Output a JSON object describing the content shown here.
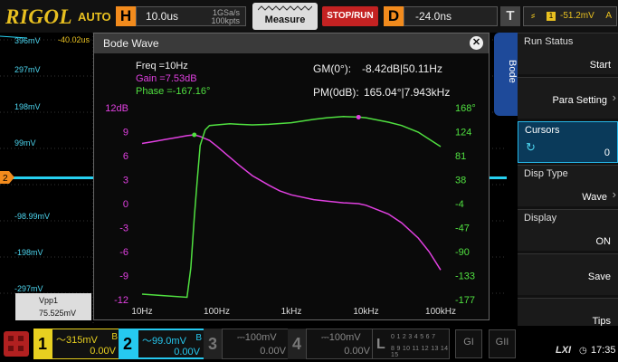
{
  "header": {
    "brand": "RIGOL",
    "mode": "AUTO",
    "horizontal": {
      "key": "H",
      "timebase": "10.0us",
      "sample_rate": "1GSa/s",
      "memory_depth": "100kpts"
    },
    "measure_label": "Measure",
    "run_state_label": "STOP/RUN",
    "delay": {
      "key": "D",
      "value": "-24.0ns"
    },
    "trigger": {
      "key": "T",
      "channel": "1",
      "level": "-51.2mV",
      "mode": "A"
    }
  },
  "waveform": {
    "scale_labels": [
      "396mV",
      "297mV",
      "198mV",
      "99mV",
      "-98.99mV",
      "-198mV",
      "-297mV"
    ],
    "offset_label": "-40.02us",
    "measurement": {
      "name": "Vpp1",
      "value": "75.525mV"
    }
  },
  "dialog": {
    "title": "Bode Wave",
    "freq_label": "Freq =10Hz",
    "gain_label": "Gain =7.53dB",
    "phase_label": "Phase =-167.16°",
    "gm_label": "GM(0°):",
    "gm_value": "-8.42dB|50.11Hz",
    "pm_label": "PM(0dB):",
    "pm_value": "165.04°|7.943kHz"
  },
  "chart_data": {
    "type": "line",
    "title": "",
    "x_scale": "log",
    "xlim": [
      10,
      100000
    ],
    "x_ticks": [
      "10Hz",
      "100Hz",
      "1kHz",
      "10kHz",
      "100kHz"
    ],
    "y_left": {
      "label": "",
      "unit": "dB",
      "lim": [
        -12,
        12
      ],
      "ticks": [
        "12dB",
        "9",
        "6",
        "3",
        "0",
        "-3",
        "-6",
        "-9",
        "-12"
      ]
    },
    "y_right": {
      "label": "",
      "unit": "°",
      "lim": [
        -177,
        168
      ],
      "ticks": [
        "168°",
        "124",
        "81",
        "38",
        "-4",
        "-47",
        "-90",
        "-133",
        "-177"
      ]
    },
    "grid": false,
    "legend": "none",
    "series": [
      {
        "axis": "left",
        "color": "#e040e0",
        "x": [
          10,
          15,
          20,
          30,
          40,
          50,
          60,
          80,
          100,
          150,
          200,
          300,
          500,
          700,
          1000,
          2000,
          3000,
          5000,
          7943,
          10000,
          20000,
          30000,
          50000,
          70000,
          100000
        ],
        "y": [
          7.53,
          7.8,
          8.0,
          8.3,
          8.5,
          8.6,
          8.4,
          7.9,
          7.2,
          5.8,
          4.8,
          3.5,
          2.3,
          1.6,
          1.1,
          0.5,
          0.3,
          0.1,
          0.0,
          -0.2,
          -1.3,
          -2.4,
          -4.3,
          -6.0,
          -8.3
        ]
      },
      {
        "axis": "right",
        "color": "#50e040",
        "x": [
          10,
          20,
          40,
          45,
          50,
          55,
          60,
          70,
          80,
          100,
          150,
          200,
          300,
          500,
          1000,
          2000,
          3000,
          5000,
          7943,
          10000,
          20000,
          30000,
          50000,
          100000
        ],
        "y": [
          -167.16,
          -170,
          -173,
          -120,
          -30,
          40,
          100,
          128,
          136,
          137,
          139,
          138,
          137,
          138,
          141,
          147,
          150,
          152,
          151,
          150,
          142,
          136,
          124,
          98
        ]
      }
    ],
    "markers": [
      {
        "axis": "left",
        "x": 50.11,
        "y": 8.6,
        "color": "#50e040"
      },
      {
        "axis": "right",
        "x": 7943,
        "y": 151,
        "color": "#e040e0"
      }
    ]
  },
  "panel": {
    "tab_label": "Bode",
    "items": [
      {
        "label": "Run Status",
        "value": "Start",
        "chevron": false
      },
      {
        "label": "",
        "value": "Para Setting",
        "chevron": true
      },
      {
        "label": "Cursors",
        "value": "0",
        "chevron": false,
        "active": true
      },
      {
        "label": "Disp Type",
        "value": "Wave",
        "chevron": true
      },
      {
        "label": "Display",
        "value": "ON",
        "chevron": false
      },
      {
        "label": "",
        "value": "Save",
        "chevron": false
      },
      {
        "label": "",
        "value": "Tips",
        "chevron": false
      }
    ]
  },
  "channels": [
    {
      "number": "1",
      "scale": "315mV",
      "coupling": "B",
      "offset": "0.00V"
    },
    {
      "number": "2",
      "scale": "99.0mV",
      "coupling": "B",
      "offset": "0.00V"
    },
    {
      "number": "3",
      "scale": "100mV",
      "coupling": "",
      "offset": "0.00V"
    },
    {
      "number": "4",
      "scale": "100mV",
      "coupling": "",
      "offset": "0.00V"
    }
  ],
  "logic": {
    "key": "L",
    "row1": "0 1 2 3 4 5 6 7",
    "row2": "8 9 10 11 12 13 14 15"
  },
  "generators": [
    "GI",
    "GII"
  ],
  "status": {
    "usb": "LXI",
    "time": "17:35"
  }
}
